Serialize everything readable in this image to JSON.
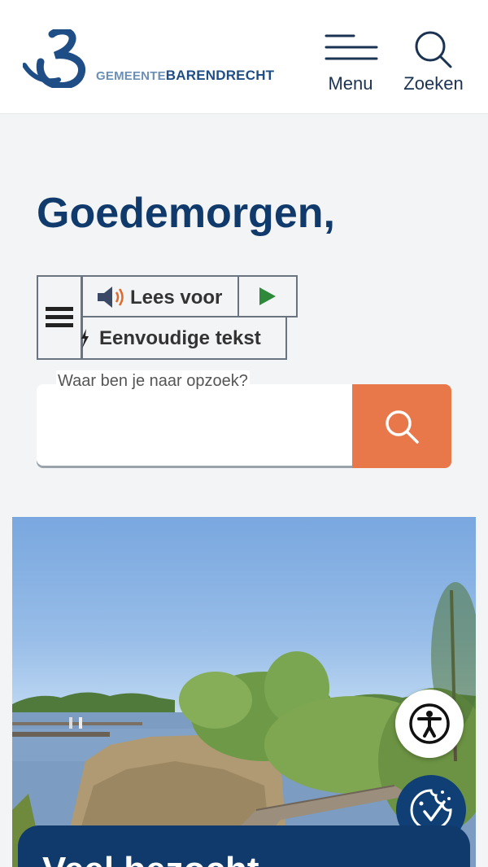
{
  "header": {
    "logo_text_1": "GEMEENTE",
    "logo_text_2": "BARENDRECHT",
    "menu_label": "Menu",
    "search_label": "Zoeken"
  },
  "main": {
    "greeting": "Goedemorgen,"
  },
  "readspeaker": {
    "listen_label": "Lees voor",
    "simple_text_label": "Eenvoudige tekst"
  },
  "search": {
    "label": "Waar ben je naar opzoek?",
    "placeholder": ""
  },
  "cards": {
    "visited_title": "Veel bezocht"
  },
  "colors": {
    "brand_blue": "#0f3a6b",
    "accent_orange": "#e8784a",
    "background": "#f2f4f6"
  },
  "icons": {
    "menu": "hamburger-icon",
    "search": "magnifier-icon",
    "speaker": "speaker-icon",
    "play": "play-icon",
    "accessibility": "accessibility-icon",
    "cookie": "cookie-consent-icon"
  }
}
